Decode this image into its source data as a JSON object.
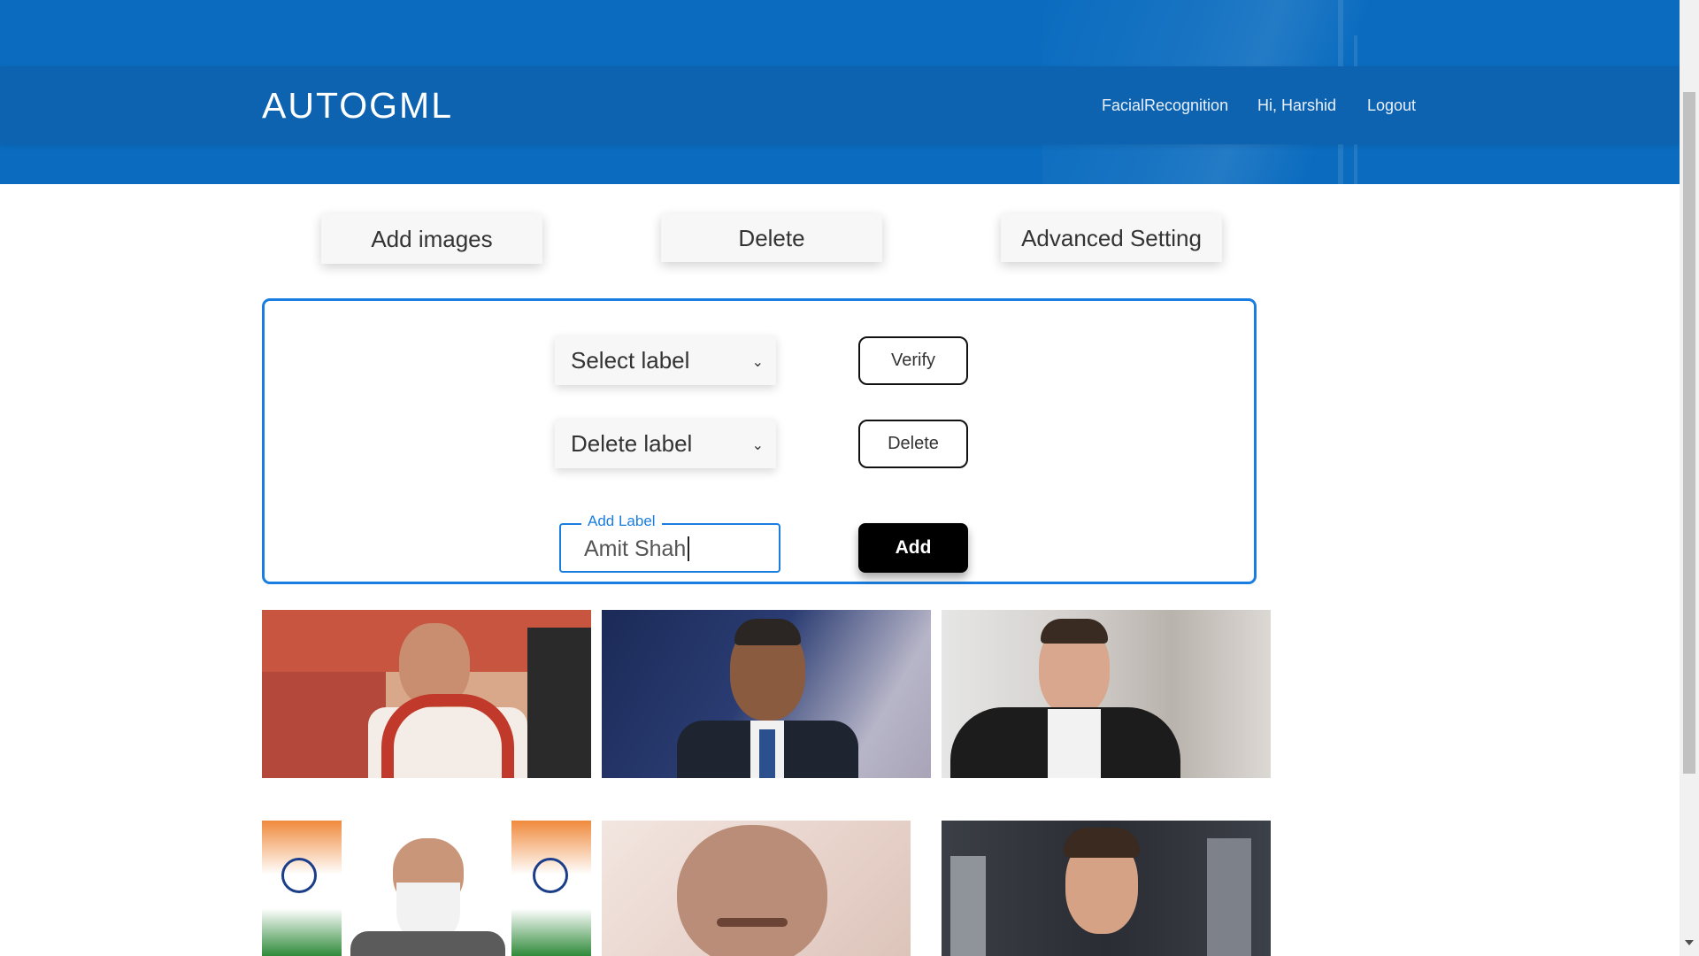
{
  "header": {
    "brand": "AUTOGML",
    "nav": {
      "facial": "FacialRecognition",
      "greeting": "Hi, Harshid",
      "logout": "Logout"
    }
  },
  "toolbar": {
    "add_images": "Add images",
    "delete": "Delete",
    "advanced": "Advanced Setting"
  },
  "panel": {
    "select_label": "Select label",
    "verify": "Verify",
    "delete_label": "Delete label",
    "delete": "Delete",
    "add_label_legend": "Add Label",
    "add_label_value": "Amit Shah",
    "add": "Add"
  },
  "gallery": [
    {
      "name": "photo-amit-shah"
    },
    {
      "name": "photo-barack-obama"
    },
    {
      "name": "photo-elon-musk"
    },
    {
      "name": "photo-narendra-modi"
    },
    {
      "name": "photo-sardar-patel"
    },
    {
      "name": "photo-tom-cruise"
    }
  ],
  "colors": {
    "header_bg": "#0b6cbf",
    "navbar_bg": "#0d63b0",
    "accent": "#1a7ee0",
    "add_button": "#000000"
  }
}
